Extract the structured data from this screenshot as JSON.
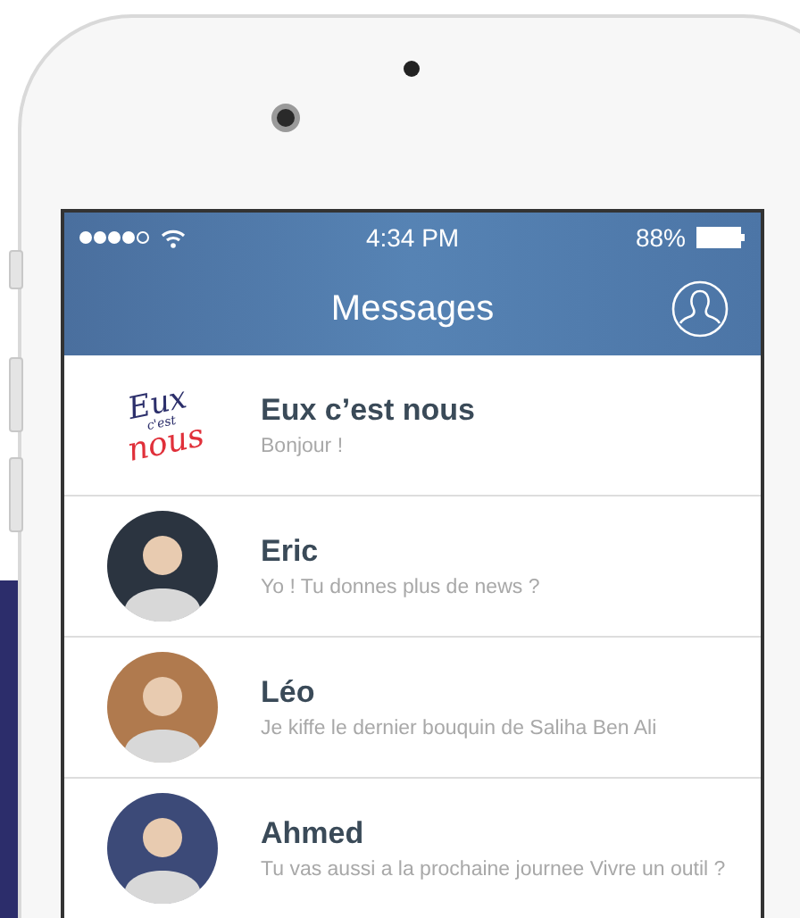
{
  "status_bar": {
    "time": "4:34 PM",
    "battery": "88%"
  },
  "nav_bar": {
    "title": "Messages"
  },
  "conversations": [
    {
      "kind": "logo",
      "logo_lines": [
        "Eux",
        "c'est",
        "nous"
      ],
      "name": "Eux c’est nous",
      "preview": "Bonjour !"
    },
    {
      "kind": "avatar",
      "color": "#2b3440",
      "name": "Eric",
      "preview": "Yo ! Tu donnes plus de news ?"
    },
    {
      "kind": "avatar",
      "color": "#b07a4e",
      "name": "Léo",
      "preview": "Je kiffe le dernier bouquin de Saliha Ben Ali"
    },
    {
      "kind": "avatar",
      "color": "#3c4a78",
      "name": "Ahmed",
      "preview": "Tu vas aussi a la prochaine journee Vivre un outil ?"
    }
  ]
}
